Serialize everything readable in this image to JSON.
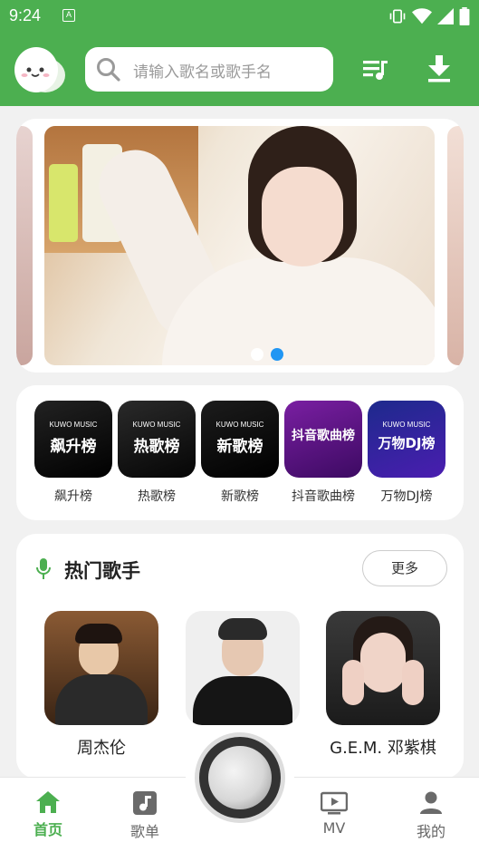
{
  "status_bar": {
    "time": "9:24",
    "notif_letter": "A"
  },
  "header": {
    "search_placeholder": "请输入歌名或歌手名",
    "colors": {
      "brand": "#4caf50"
    }
  },
  "banner": {
    "dots": 2,
    "active_dot": 2
  },
  "charts": [
    {
      "label": "飙升榜",
      "cover_text": "飙升榜",
      "brand": "KUWO MUSIC"
    },
    {
      "label": "热歌榜",
      "cover_text": "热歌榜",
      "brand": "KUWO MUSIC"
    },
    {
      "label": "新歌榜",
      "cover_text": "新歌榜",
      "brand": "KUWO MUSIC"
    },
    {
      "label": "抖音歌曲榜",
      "cover_text": "抖音歌曲榜",
      "brand": ""
    },
    {
      "label": "万物DJ榜",
      "cover_text": "万物DJ榜",
      "brand": "KUWO MUSIC"
    }
  ],
  "hot_singers": {
    "title": "热门歌手",
    "more_label": "更多",
    "singers": [
      {
        "name": "周杰伦"
      },
      {
        "name": ""
      },
      {
        "name": "G.E.M. 邓紫棋"
      }
    ]
  },
  "bottom_nav": {
    "items": [
      {
        "label": "首页",
        "icon": "home-icon",
        "active": true
      },
      {
        "label": "歌单",
        "icon": "music-note-icon",
        "active": false
      },
      {
        "label": "MV",
        "icon": "tv-play-icon",
        "active": false
      },
      {
        "label": "我的",
        "icon": "person-icon",
        "active": false
      }
    ]
  }
}
